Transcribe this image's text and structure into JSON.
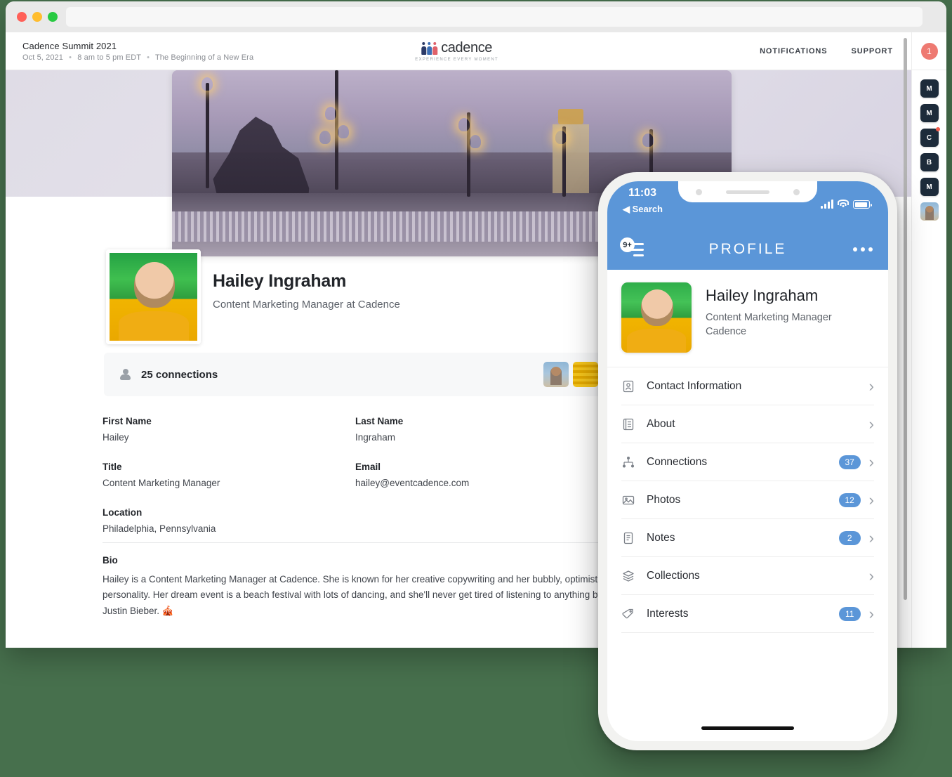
{
  "browser": {
    "traffic_lights": [
      "close",
      "minimize",
      "maximize"
    ],
    "url_value": "",
    "url_placeholder": ""
  },
  "app_header": {
    "event_title": "Cadence Summit 2021",
    "event_date": "Oct 5, 2021",
    "event_time": "8 am to 5 pm EDT",
    "event_tagline": "The Beginning of a New Era",
    "separator": "•",
    "logo_text": "cadence",
    "logo_tagline": "EXPERIENCE EVERY MOMENT",
    "nav": [
      {
        "label": "NOTIFICATIONS"
      },
      {
        "label": "SUPPORT"
      }
    ]
  },
  "rail": {
    "badge_count": "1",
    "tiles": [
      {
        "label": "M",
        "has_dot": false
      },
      {
        "label": "M",
        "has_dot": false
      },
      {
        "label": "C",
        "has_dot": true
      },
      {
        "label": "B",
        "has_dot": false
      },
      {
        "label": "M",
        "has_dot": false
      }
    ],
    "avatar_name": "user-avatar"
  },
  "profile": {
    "cover_alt": "Pont Alexandre III bridge in Paris at dusk",
    "avatar_alt": "Hailey Ingraham profile photo",
    "name": "Hailey Ingraham",
    "role": "Content Marketing Manager at Cadence",
    "connections_label": "25 connections",
    "fields": [
      {
        "label": "First Name",
        "value": "Hailey"
      },
      {
        "label": "Last Name",
        "value": "Ingraham"
      },
      {
        "label": "Title",
        "value": "Content Marketing Manager"
      },
      {
        "label": "Email",
        "value": "hailey@eventcadence.com"
      },
      {
        "label": "Location",
        "value": "Philadelphia, Pennsylvania"
      }
    ],
    "bio_label": "Bio",
    "bio_text": "Hailey is a Content Marketing Manager at Cadence. She is known for her creative copywriting and her bubbly, optimistic personality. Her dream event is a beach festival with lots of dancing, and she'll never get tired of listening to anything by Justin Bieber. 🎪"
  },
  "phone": {
    "status": {
      "time": "11:03",
      "back_label": "Search",
      "back_glyph": "◀"
    },
    "navbar": {
      "menu_badge": "9+",
      "title": "PROFILE",
      "more_label": "more-options"
    },
    "profile": {
      "name": "Hailey Ingraham",
      "role_line1": "Content Marketing Manager",
      "role_line2": "Cadence"
    },
    "menu": [
      {
        "label": "Contact Information",
        "icon": "contact-card-icon",
        "badge": ""
      },
      {
        "label": "About",
        "icon": "about-document-icon",
        "badge": ""
      },
      {
        "label": "Connections",
        "icon": "connections-network-icon",
        "badge": "37"
      },
      {
        "label": "Photos",
        "icon": "photos-image-icon",
        "badge": "12"
      },
      {
        "label": "Notes",
        "icon": "notes-clipboard-icon",
        "badge": "2"
      },
      {
        "label": "Collections",
        "icon": "collections-layers-icon",
        "badge": ""
      },
      {
        "label": "Interests",
        "icon": "interests-tag-icon",
        "badge": "11"
      }
    ],
    "chevron_glyph": "›"
  },
  "colors": {
    "page_background": "#47704d",
    "phone_accent": "#5b96d8",
    "rail_tile": "#1d2b3a",
    "badge_red": "#ee7a72",
    "notif_dot": "#ef5b4c"
  }
}
